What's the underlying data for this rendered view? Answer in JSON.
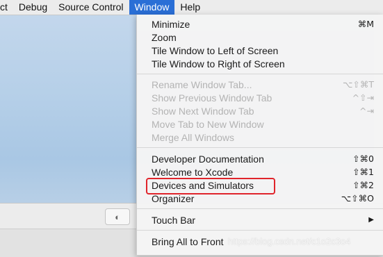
{
  "menubar": {
    "items": [
      "ct",
      "Debug",
      "Source Control",
      "Window",
      "Help"
    ]
  },
  "window_menu": {
    "items": [
      {
        "label": "Minimize",
        "shortcut": "⌘M",
        "enabled": true
      },
      {
        "label": "Zoom",
        "shortcut": "",
        "enabled": true
      },
      {
        "label": "Tile Window to Left of Screen",
        "shortcut": "",
        "enabled": true
      },
      {
        "label": "Tile Window to Right of Screen",
        "shortcut": "",
        "enabled": true
      },
      {
        "label": "Rename Window Tab...",
        "shortcut": "⌥⇧⌘T",
        "enabled": false
      },
      {
        "label": "Show Previous Window Tab",
        "shortcut": "^⇧⇥",
        "enabled": false
      },
      {
        "label": "Show Next Window Tab",
        "shortcut": "^⇥",
        "enabled": false
      },
      {
        "label": "Move Tab to New Window",
        "shortcut": "",
        "enabled": false
      },
      {
        "label": "Merge All Windows",
        "shortcut": "",
        "enabled": false
      },
      {
        "label": "Developer Documentation",
        "shortcut": "⇧⌘0",
        "enabled": true
      },
      {
        "label": "Welcome to Xcode",
        "shortcut": "⇧⌘1",
        "enabled": true
      },
      {
        "label": "Devices and Simulators",
        "shortcut": "⇧⌘2",
        "enabled": true
      },
      {
        "label": "Organizer",
        "shortcut": "⌥⇧⌘O",
        "enabled": true
      },
      {
        "label": "Touch Bar",
        "shortcut": "▶",
        "enabled": true
      },
      {
        "label": "Bring All to Front",
        "shortcut": "",
        "enabled": true
      }
    ]
  },
  "toolbar_toggle_glyph": "◐",
  "watermark": "https://blog.csdn.net/c1o2c3o4",
  "colors": {
    "menubar_active": "#2a6fd6",
    "highlight_box": "#e0242b",
    "disabled_text": "#b3b3b3"
  }
}
